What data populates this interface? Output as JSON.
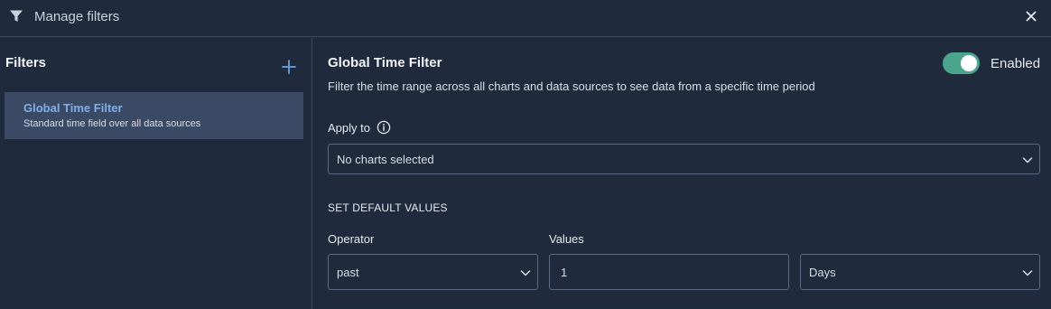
{
  "header": {
    "title": "Manage filters",
    "icons": {
      "filter": "filter-icon",
      "close": "close-icon"
    }
  },
  "sidebar": {
    "heading": "Filters",
    "add_icon": "plus-icon",
    "items": [
      {
        "name": "Global Time Filter",
        "description": "Standard time field over all data sources"
      }
    ]
  },
  "filter": {
    "title": "Global Time Filter",
    "description": "Filter the time range across all charts and data sources to see data from a specific time period",
    "toggle_label": "Enabled",
    "enabled": true,
    "apply_to": {
      "label": "Apply to",
      "value": "No charts selected"
    },
    "defaults": {
      "section_title": "SET DEFAULT VALUES",
      "operator_label": "Operator",
      "operator_value": "past",
      "values_label": "Values",
      "value": "1",
      "unit": "Days"
    }
  },
  "colors": {
    "background": "#1f2a3c",
    "selected_item": "#3a4a65",
    "accent_link": "#7fb0ea",
    "toggle_on": "#4aa58c",
    "plus": "#6fa3e0"
  }
}
